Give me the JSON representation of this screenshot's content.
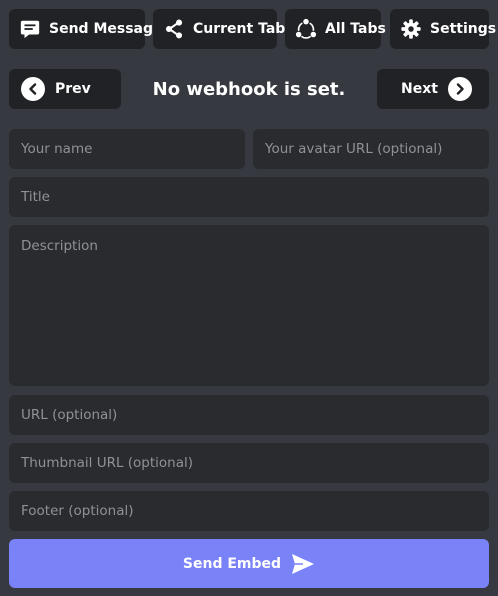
{
  "tabs": {
    "send_message": {
      "label": "Send Message",
      "icon": "message-icon"
    },
    "current_tab": {
      "label": "Current Tab",
      "icon": "share-icon"
    },
    "all_tabs": {
      "label": "All Tabs",
      "icon": "nodes-icon"
    },
    "settings": {
      "label": "Settings",
      "icon": "gear-icon"
    }
  },
  "nav": {
    "prev_label": "Prev",
    "next_label": "Next",
    "status": "No webhook is set."
  },
  "form": {
    "name_placeholder": "Your name",
    "avatar_placeholder": "Your avatar URL (optional)",
    "title_placeholder": "Title",
    "description_placeholder": "Description",
    "url_placeholder": "URL (optional)",
    "thumbnail_placeholder": "Thumbnail URL (optional)",
    "footer_placeholder": "Footer (optional)"
  },
  "submit": {
    "label": "Send Embed",
    "icon": "send-icon"
  },
  "colors": {
    "background": "#36393f",
    "button_dark": "#202225",
    "input": "#292b2f",
    "accent": "#7a82f8",
    "text": "#ffffff",
    "placeholder": "#8e9297"
  }
}
